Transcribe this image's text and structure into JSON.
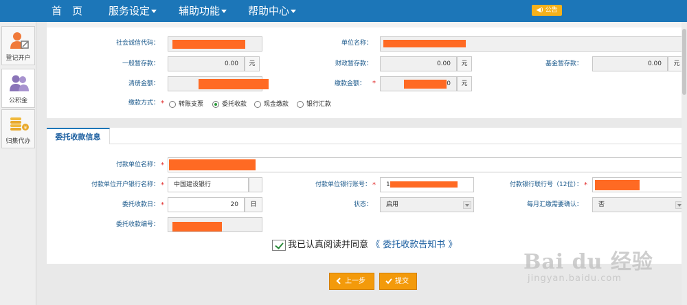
{
  "nav": {
    "home": "首　页",
    "service": "服务设定",
    "assist": "辅助功能",
    "help": "帮助中心",
    "notice": "公告"
  },
  "sidebar": {
    "items": [
      {
        "label": "登记开户"
      },
      {
        "label": "公积金"
      },
      {
        "label": "归集代办"
      }
    ]
  },
  "payment": {
    "credit_code_label": "社会诚信代码：",
    "unit_name_label": "单位名称：",
    "general_deposit_label": "一般暂存款：",
    "general_deposit_value": "0.00",
    "finance_deposit_label": "财政暂存款：",
    "finance_deposit_value": "0.00",
    "fund_deposit_label": "基金暂存款：",
    "fund_deposit_value": "0.00",
    "unit_yuan": "元",
    "roster_amount_label": "清册金额：",
    "pay_amount_label": "缴款金额：",
    "pay_amount_tail": "0",
    "method_label": "缴款方式：",
    "methods": [
      "转账支票",
      "委托收款",
      "现金缴款",
      "银行汇款"
    ],
    "selected_method": "委托收款"
  },
  "entrust": {
    "tab_title": "委托收款信息",
    "payer_name_label": "付款单位名称：",
    "bank_name_label": "付款单位开户银行名称：",
    "bank_name_value": "中国建设银行",
    "account_label": "付款单位银行账号：",
    "account_prefix": "1",
    "bank_no_label": "付款银行联行号（12位）：",
    "day_label": "委托收款日：",
    "day_value": "20",
    "day_unit": "日",
    "status_label": "状态：",
    "status_value": "启用",
    "confirm_label": "每月汇缴需要确认：",
    "confirm_value": "否",
    "code_label": "委托收款编号："
  },
  "agreement": {
    "text": "我已认真阅读并同意",
    "link": "《 委托收款告知书 》"
  },
  "buttons": {
    "prev": "上一步",
    "submit": "提交"
  },
  "watermark": {
    "big": "Bai du 经验",
    "small": "jingyan.baidu.com"
  },
  "colors": {
    "nav": "#1c76b8",
    "accent": "#f39a0b",
    "redaction": "#ff6a23"
  }
}
